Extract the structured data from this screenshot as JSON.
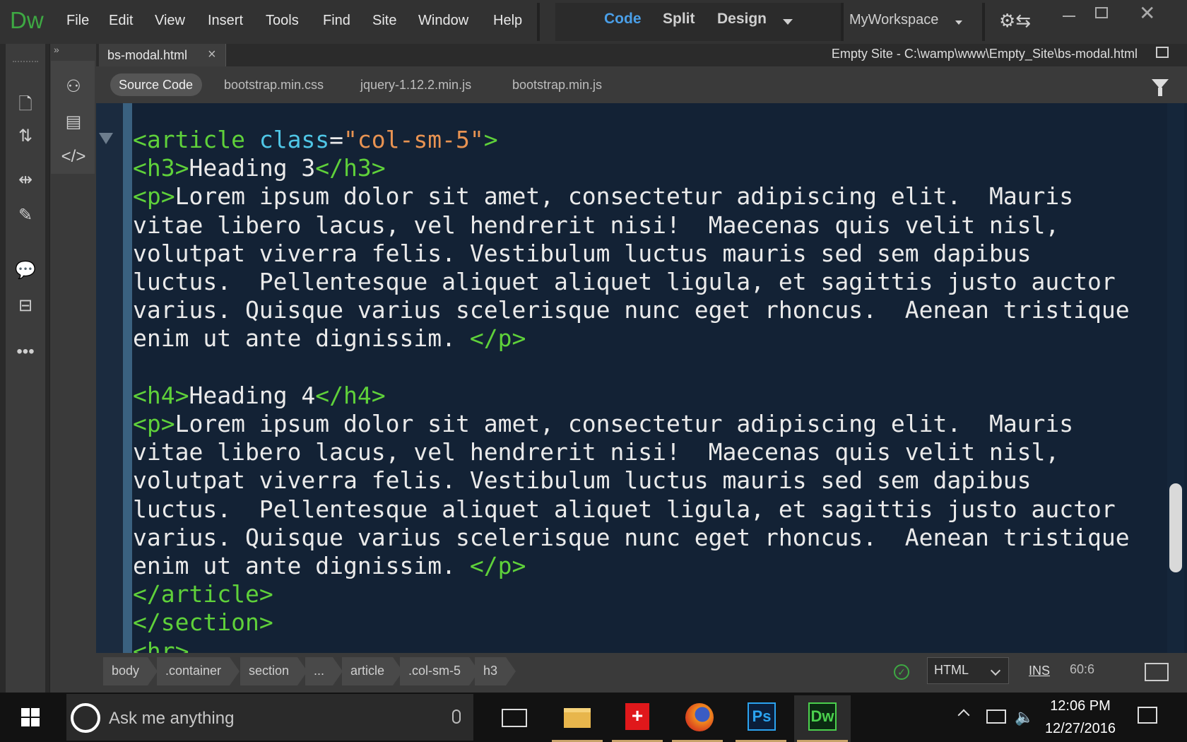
{
  "app": {
    "logo": "Dw",
    "menu": [
      "File",
      "Edit",
      "View",
      "Insert",
      "Tools",
      "Find",
      "Site",
      "Window",
      "Help"
    ],
    "view_modes": {
      "code": "Code",
      "split": "Split",
      "design": "Design"
    },
    "workspace": "MyWorkspace"
  },
  "document": {
    "tab_label": "bs-modal.html",
    "tab_close": "×",
    "site_path": "Empty Site - C:\\wamp\\www\\Empty_Site\\bs-modal.html"
  },
  "related_files": {
    "active": "Source Code",
    "files": [
      "bootstrap.min.css",
      "jquery-1.12.2.min.js",
      "bootstrap.min.js"
    ]
  },
  "code_lines": [
    "<article class=\"col-sm-5\">",
    "<h3>Heading 3</h3>",
    "<p>Lorem ipsum dolor sit amet, consectetur adipiscing elit.  Mauris",
    "vitae libero lacus, vel hendrerit nisi!  Maecenas quis velit nisl,",
    "volutpat viverra felis. Vestibulum luctus mauris sed sem dapibus",
    "luctus.  Pellentesque aliquet aliquet ligula, et sagittis justo auctor",
    "varius. Quisque varius scelerisque nunc eget rhoncus.  Aenean tristique",
    "enim ut ante dignissim. </p>",
    "",
    "<h4>Heading 4</h4>",
    "<p>Lorem ipsum dolor sit amet, consectetur adipiscing elit.  Mauris",
    "vitae libero lacus, vel hendrerit nisi!  Maecenas quis velit nisl,",
    "volutpat viverra felis. Vestibulum luctus mauris sed sem dapibus",
    "luctus.  Pellentesque aliquet aliquet ligula, et sagittis justo auctor",
    "varius. Quisque varius scelerisque nunc eget rhoncus.  Aenean tristique",
    "enim ut ante dignissim. </p>",
    "</article>",
    "</section>",
    "<hr>"
  ],
  "status": {
    "breadcrumbs": [
      "body",
      ".container",
      "section",
      "...",
      "article",
      ".col-sm-5",
      "h3"
    ],
    "language": "HTML",
    "mode": "INS",
    "cursor_position": "60:6"
  },
  "taskbar": {
    "search_placeholder": "Ask me anything",
    "ps_label": "Ps",
    "dw_label": "Dw",
    "time": "12:06 PM",
    "date": "12/27/2016"
  },
  "colors": {
    "code_bg": "#132235",
    "tag": "#5fd13a",
    "attribute": "#4fc6e6",
    "string": "#e89352",
    "active_view": "#4a9fe8",
    "dw_green": "#3ea843"
  }
}
